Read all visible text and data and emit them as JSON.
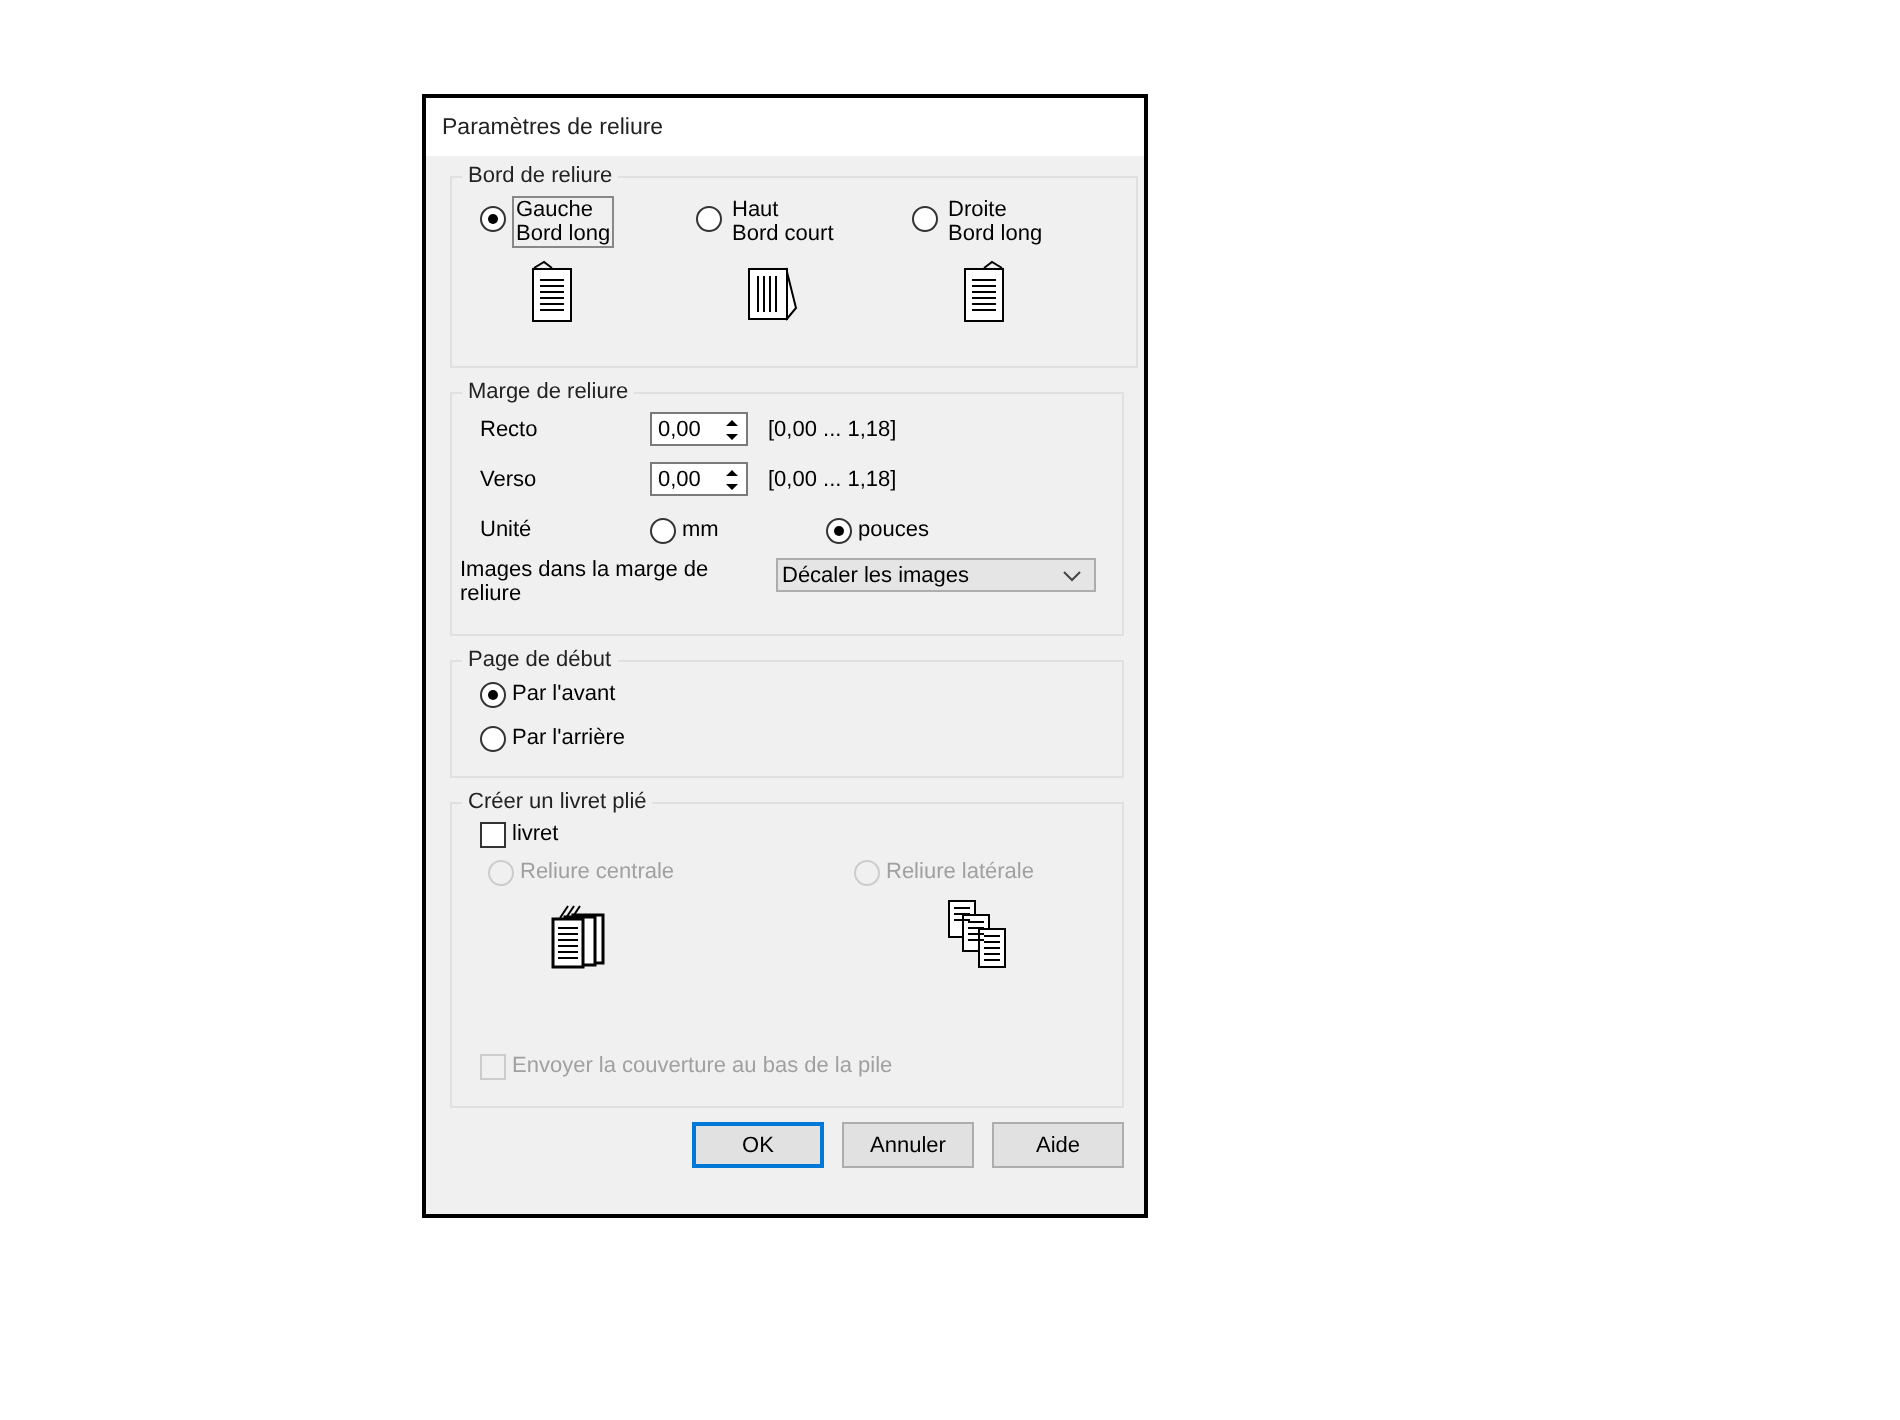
{
  "window": {
    "title": "Paramètres de reliure"
  },
  "binding_edge": {
    "title": "Bord de reliure",
    "options": [
      {
        "line1": "Gauche",
        "line2": "Bord long",
        "selected": true,
        "kind": "left"
      },
      {
        "line1": "Haut",
        "line2": "Bord court",
        "selected": false,
        "kind": "top"
      },
      {
        "line1": "Droite",
        "line2": "Bord long",
        "selected": false,
        "kind": "right"
      }
    ]
  },
  "margin": {
    "title": "Marge de reliure",
    "fields": [
      {
        "label": "Recto",
        "value": "0,00",
        "range": "[0,00 ... 1,18]"
      },
      {
        "label": "Verso",
        "value": "0,00",
        "range": "[0,00 ... 1,18]"
      }
    ],
    "unit_label": "Unité",
    "units": [
      {
        "label": "mm",
        "selected": false
      },
      {
        "label": "pouces",
        "selected": true
      }
    ],
    "images_label": "Images dans la marge de reliure",
    "images_value": "Décaler les images"
  },
  "start_page": {
    "title": "Page de début",
    "options": [
      {
        "label": "Par l'avant",
        "selected": true
      },
      {
        "label": "Par l'arrière",
        "selected": false
      }
    ]
  },
  "booklet": {
    "title": "Créer un livret plié",
    "checkbox": {
      "label": "livret",
      "checked": false
    },
    "options": [
      {
        "label": "Reliure centrale",
        "selected": false,
        "disabled": true,
        "kind": "center"
      },
      {
        "label": "Reliure latérale",
        "selected": false,
        "disabled": true,
        "kind": "side"
      }
    ],
    "cover": {
      "label": "Envoyer la couverture au bas de la pile",
      "checked": false,
      "disabled": true
    }
  },
  "buttons": [
    {
      "label": "OK",
      "default": true
    },
    {
      "label": "Annuler",
      "default": false
    },
    {
      "label": "Aide",
      "default": false
    }
  ]
}
